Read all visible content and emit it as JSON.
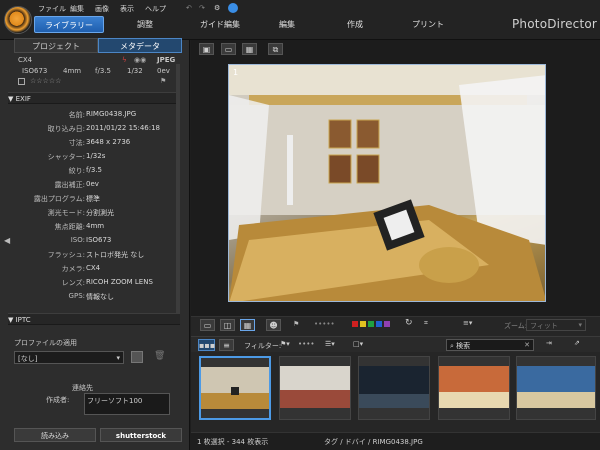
{
  "menu": [
    "ファイル",
    "編集",
    "画像",
    "表示",
    "ヘルプ"
  ],
  "main_tabs": {
    "library": "ライブラリー",
    "adjust": "調整",
    "guided": "ガイド編集",
    "edit": "編集",
    "create": "作成",
    "print": "プリント"
  },
  "brand": "PhotoDirector",
  "panel_tabs": {
    "project": "プロジェクト",
    "metadata": "メタデータ"
  },
  "camera": {
    "model": "CX4",
    "format": "JPEG",
    "iso": "ISO673",
    "focal": "4mm",
    "fstop": "f/3.5",
    "shutter": "1/32",
    "ev": "0ev"
  },
  "exif": {
    "title": "EXIF",
    "rows": [
      {
        "label": "名前:",
        "value": "RIMG0438.JPG"
      },
      {
        "label": "取り込み日:",
        "value": "2011/01/22 15:46:18"
      },
      {
        "label": "寸法:",
        "value": "3648 x 2736"
      },
      {
        "label": "シャッター:",
        "value": "1/32s"
      },
      {
        "label": "絞り:",
        "value": "f/3.5"
      },
      {
        "label": "露出補正:",
        "value": "0ev"
      },
      {
        "label": "露出プログラム:",
        "value": "標準"
      },
      {
        "label": "測光モード:",
        "value": "分割測光"
      },
      {
        "label": "焦点距離:",
        "value": "4mm"
      },
      {
        "label": "ISO:",
        "value": "ISO673"
      },
      {
        "label": "フラッシュ:",
        "value": "ストロボ発光 なし"
      },
      {
        "label": "カメラ:",
        "value": "CX4"
      },
      {
        "label": "レンズ:",
        "value": "RICOH ZOOM LENS"
      },
      {
        "label": "GPS:",
        "value": "情報なし"
      }
    ]
  },
  "iptc": {
    "title": "IPTC",
    "profile_label": "プロファイルの適用",
    "profile_value": "[なし]",
    "contact_header": "連絡先",
    "author_label": "作成者:",
    "author_value": "フリーソフト100"
  },
  "bottom_buttons": {
    "import": "読み込み",
    "shutterstock": "shutterstock"
  },
  "photo_index": "1",
  "toolbar": {
    "zoom_label": "ズーム:",
    "zoom_value": "フィット",
    "filter_label": "フィルター:",
    "search_placeholder": "検索"
  },
  "colors": {
    "accent": "#3a7fd0",
    "labels": [
      "#d02020",
      "#e0c020",
      "#20a040",
      "#2060d0",
      "#9040b0"
    ]
  },
  "status": {
    "selection": "1 枚選択 - 344 枚表示",
    "path": "タグ / ドバイ / RIMG0438.JPG"
  }
}
